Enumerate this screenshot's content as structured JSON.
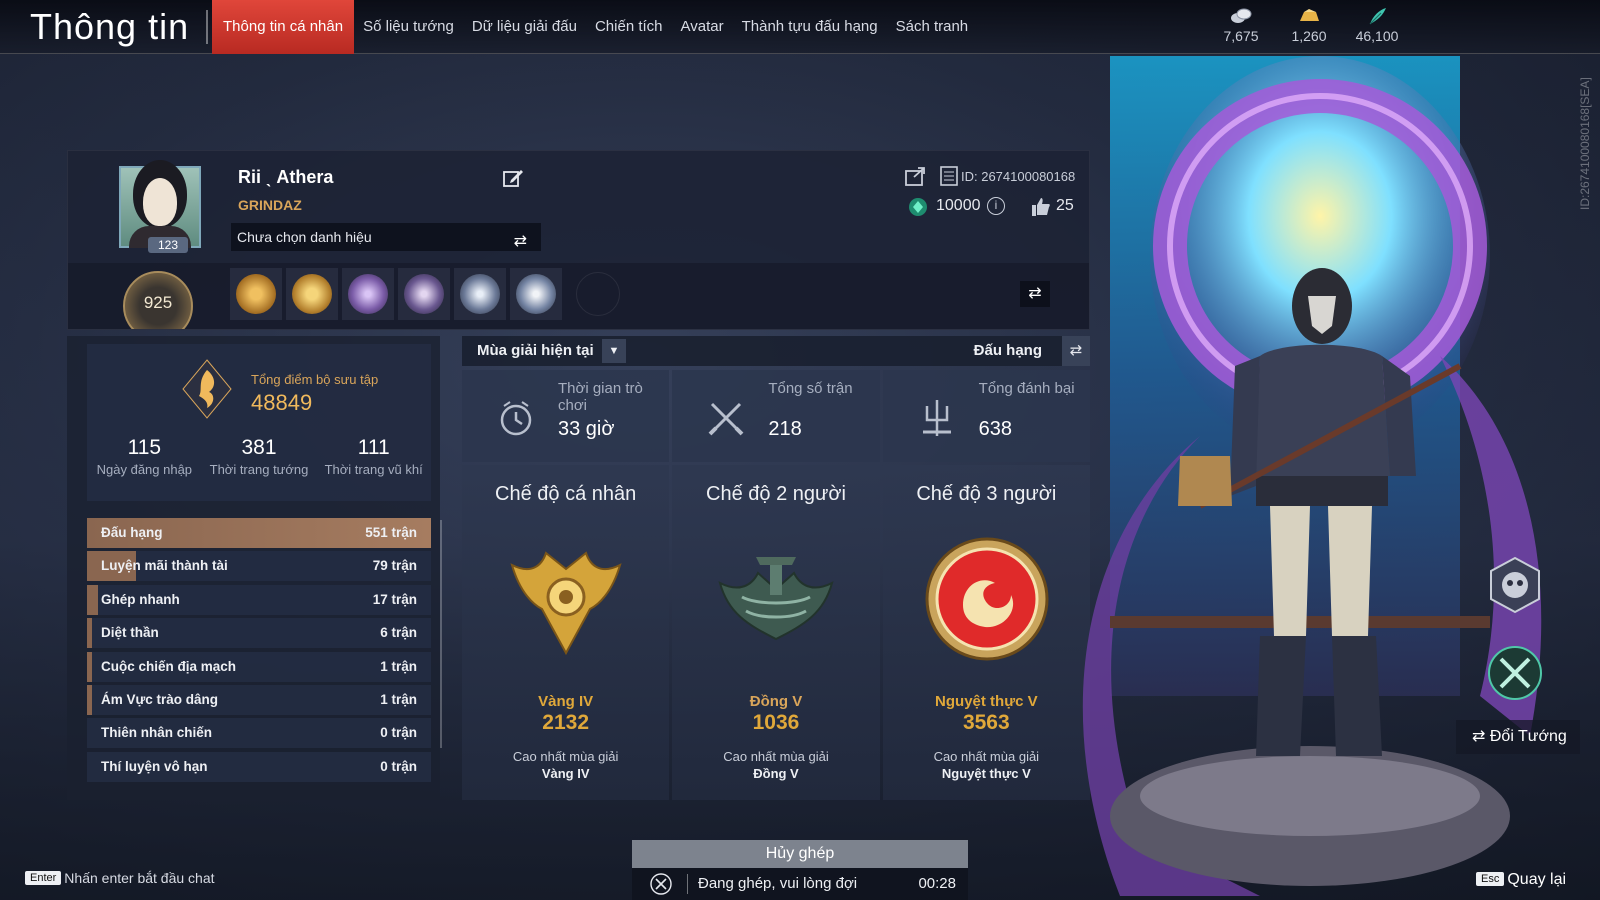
{
  "header": {
    "title": "Thông tin",
    "tabs": [
      {
        "label": "Thông tin cá nhân",
        "active": true
      },
      {
        "label": "Số liệu tướng"
      },
      {
        "label": "Dữ liệu giải đấu"
      },
      {
        "label": "Chiến tích"
      },
      {
        "label": "Avatar"
      },
      {
        "label": "Thành tựu đấu hạng"
      },
      {
        "label": "Sách tranh"
      }
    ],
    "currencies": [
      {
        "icon": "coin-stack-icon",
        "value": "7,675"
      },
      {
        "icon": "gold-ingot-icon",
        "value": "1,260"
      },
      {
        "icon": "feather-icon",
        "value": "46,100"
      }
    ]
  },
  "side_id": "ID:2674100080168[SEA]",
  "profile": {
    "level": "123",
    "name": "Rii ˎ Athera",
    "guild": "GRINDAZ",
    "title_select": "Chưa chọn danh hiệu",
    "id_text": "ID: 2674100080168",
    "power": "10000",
    "likes": "25",
    "rank_score": "925",
    "badges": [
      "badge-gold-seal",
      "badge-gold-helm",
      "badge-swirl",
      "badge-crown",
      "badge-lotus",
      "badge-wave"
    ]
  },
  "collection": {
    "label": "Tổng điểm bộ sưu tập",
    "value": "48849",
    "stats": [
      {
        "value": "115",
        "label": "Ngày đăng nhập"
      },
      {
        "value": "381",
        "label": "Thời trang tướng"
      },
      {
        "value": "111",
        "label": "Thời trang vũ khí"
      }
    ]
  },
  "modes": [
    {
      "name": "Đấu hạng",
      "count": "551 trận",
      "share": 1.0,
      "highlight": true
    },
    {
      "name": "Luyện mãi thành tài",
      "count": "79 trận",
      "share": 0.143
    },
    {
      "name": "Ghép nhanh",
      "count": "17 trận",
      "share": 0.031
    },
    {
      "name": "Diệt thần",
      "count": "6 trận",
      "share": 0.011
    },
    {
      "name": "Cuộc chiến địa mạch",
      "count": "1 trận",
      "share": 0.002
    },
    {
      "name": "Ám Vực trào dâng",
      "count": "1 trận",
      "share": 0.002
    },
    {
      "name": "Thiên nhân chiến",
      "count": "0 trận",
      "share": 0
    },
    {
      "name": "Thí luyện vô hạn",
      "count": "0 trận",
      "share": 0
    }
  ],
  "season": {
    "dropdown": "Mùa giải hiện tại",
    "filter": "Đấu hạng",
    "summary": [
      {
        "icon": "clock-icon",
        "label": "Thời gian trò chơi",
        "value": "33 giờ"
      },
      {
        "icon": "crossed-swords-icon",
        "label": "Tổng số trận",
        "value": "218"
      },
      {
        "icon": "trident-icon",
        "label": "Tổng đánh bại",
        "value": "638"
      }
    ],
    "cards": [
      {
        "title": "Chế độ cá nhân",
        "tier": "Vàng IV",
        "points": "2132",
        "high_label": "Cao nhất mùa giải",
        "high_tier": "Vàng IV",
        "color": "#e0a83a",
        "emblem": "gold-emblem-icon"
      },
      {
        "title": "Chế độ 2 người",
        "tier": "Đồng V",
        "points": "1036",
        "high_label": "Cao nhất mùa giải",
        "high_tier": "Đồng V",
        "color": "#d9a55a",
        "emblem": "bronze-emblem-icon"
      },
      {
        "title": "Chế độ 3 người",
        "tier": "Nguyệt thực V",
        "points": "3563",
        "high_label": "Cao nhất mùa giải",
        "high_tier": "Nguyệt thực V",
        "color": "#e0a83a",
        "emblem": "eclipse-emblem-icon"
      }
    ]
  },
  "hero_button": "Đổi Tướng",
  "chat": {
    "key": "Enter",
    "hint": "Nhấn enter bắt đầu chat"
  },
  "queue": {
    "cancel": "Hủy ghép",
    "status": "Đang ghép, vui lòng đợi",
    "time": "00:28"
  },
  "back": {
    "key": "Esc",
    "label": "Quay lại"
  }
}
